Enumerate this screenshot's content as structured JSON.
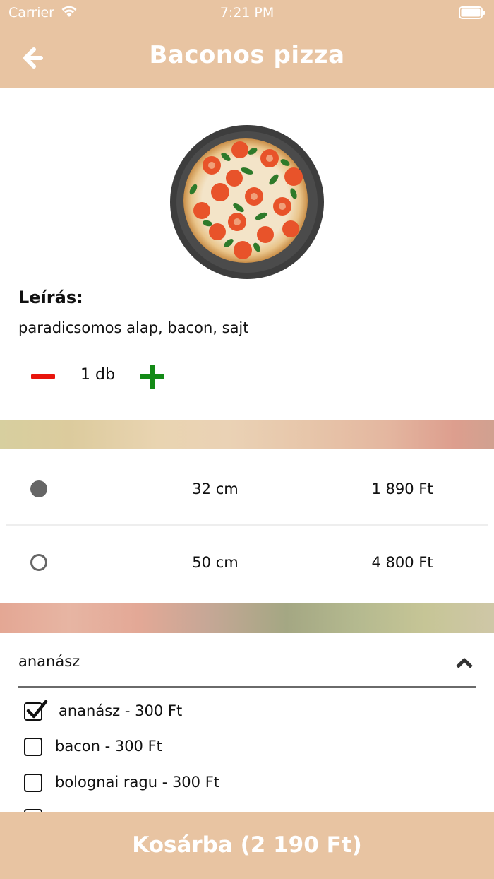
{
  "status_bar": {
    "carrier": "Carrier",
    "time": "7:21 PM"
  },
  "header": {
    "title": "Baconos pizza",
    "back_icon": "back-arrow-icon"
  },
  "product": {
    "image_icon": "pizza-image",
    "description_heading": "Leírás:",
    "description": "paradicsomos alap, bacon, sajt",
    "quantity": "1 db"
  },
  "sizes": [
    {
      "size": "32 cm",
      "price": "1 890 Ft",
      "selected": true
    },
    {
      "size": "50 cm",
      "price": "4 800 Ft",
      "selected": false
    }
  ],
  "toppings": {
    "header": "ananász",
    "items": [
      {
        "label": "ananász - 300 Ft",
        "checked": true
      },
      {
        "label": "bacon - 300 Ft",
        "checked": false
      },
      {
        "label": "bolognai ragu - 300 Ft",
        "checked": false
      }
    ]
  },
  "cart": {
    "label": "Kosárba (2 190 Ft)"
  },
  "colors": {
    "header": "#e8c4a2",
    "minus": "#e8140c",
    "plus": "#138a16"
  }
}
